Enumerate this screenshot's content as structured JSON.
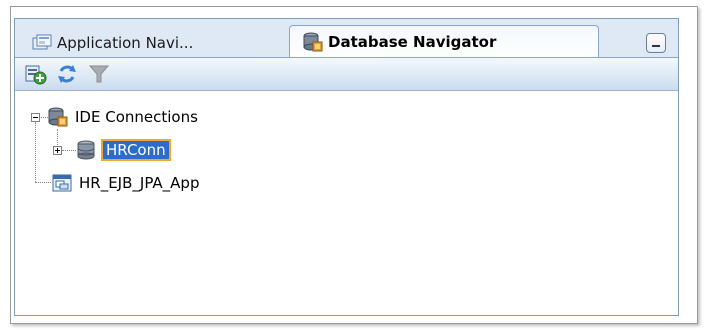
{
  "tabs": {
    "inactive_label": "Application Navi...",
    "active_label": "Database Navigator"
  },
  "toolbar": {
    "buttons": [
      "new-connection-icon",
      "refresh-icon",
      "filter-icon"
    ]
  },
  "tree": {
    "root_label": "IDE Connections",
    "child_label": "HRConn",
    "app_label": "HR_EJB_JPA_App"
  },
  "colors": {
    "panel_bg": "#dfe9f5",
    "selection_bg": "#2b6ccc",
    "selection_outline": "#f0a830"
  }
}
